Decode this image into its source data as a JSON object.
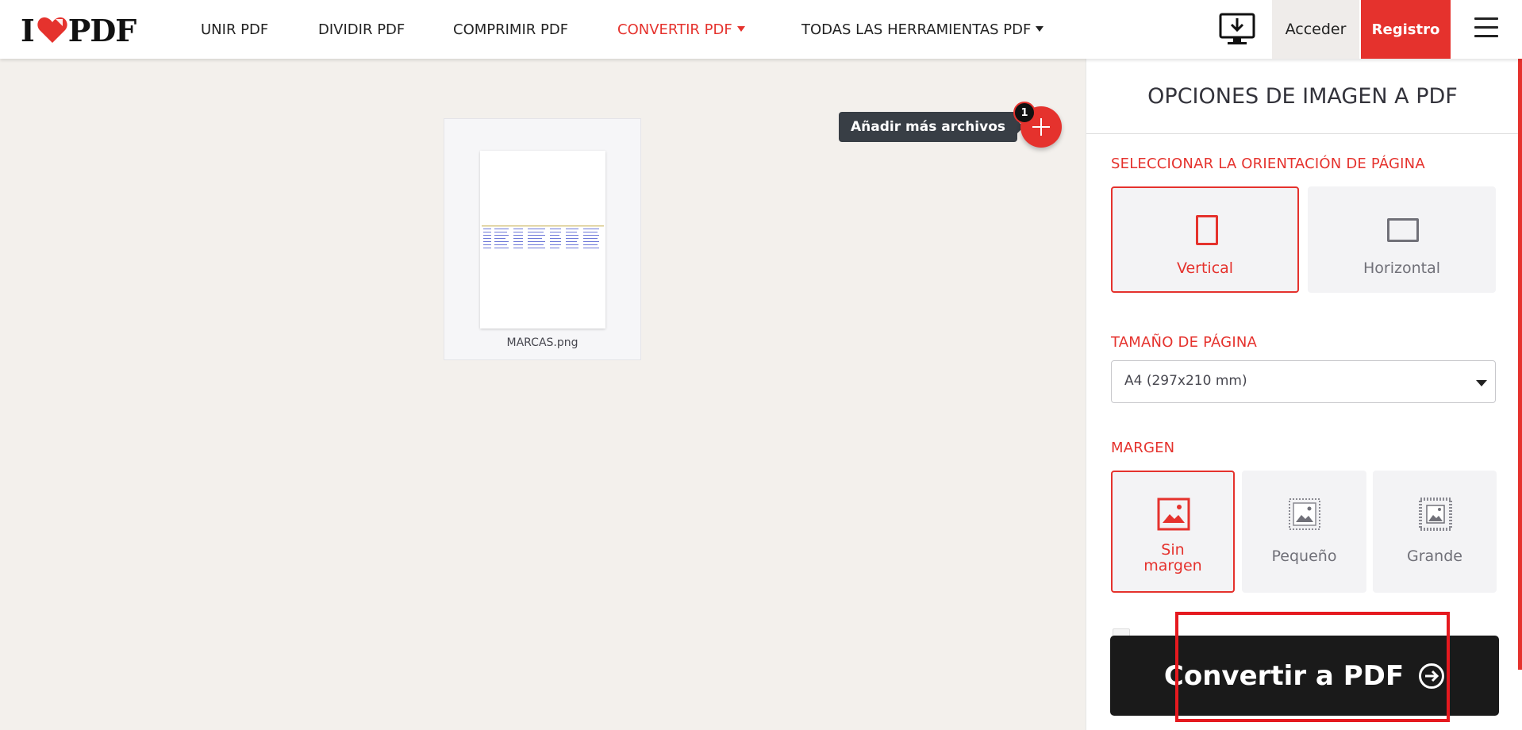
{
  "header": {
    "logo_left": "I",
    "logo_right": "PDF",
    "nav": {
      "unir": "UNIR PDF",
      "dividir": "DIVIDIR PDF",
      "comprimir": "COMPRIMIR PDF",
      "convertir": "CONVERTIR PDF",
      "todas": "TODAS LAS HERRAMIENTAS PDF"
    },
    "login": "Acceder",
    "register": "Registro"
  },
  "files": [
    {
      "name": "MARCAS.png"
    }
  ],
  "add_files": {
    "tooltip": "Añadir más archivos",
    "count": "1"
  },
  "sidebar": {
    "title": "OPCIONES DE IMAGEN A PDF",
    "orientation": {
      "label": "SELECCIONAR LA ORIENTACIÓN DE PÁGINA",
      "options": [
        "Vertical",
        "Horizontal"
      ],
      "selected": "Vertical"
    },
    "page_size": {
      "label": "TAMAÑO DE PÁGINA",
      "value": "A4 (297x210 mm)"
    },
    "margin": {
      "label": "MARGEN",
      "options": [
        "Sin margen",
        "Pequeño",
        "Grande"
      ],
      "none_line1": "Sin",
      "none_line2": "margen",
      "selected": "Sin margen"
    },
    "convert_button": "Convertir a PDF"
  },
  "colors": {
    "accent": "#e5322d",
    "dark": "#1a1a1a",
    "background": "#f3f0ec"
  },
  "icons": [
    "heart-logo-icon",
    "desktop-download-icon",
    "menu-icon",
    "plus-icon",
    "portrait-icon",
    "landscape-icon",
    "image-no-margin-icon",
    "image-small-margin-icon",
    "image-large-margin-icon",
    "arrow-right-circle-icon"
  ]
}
